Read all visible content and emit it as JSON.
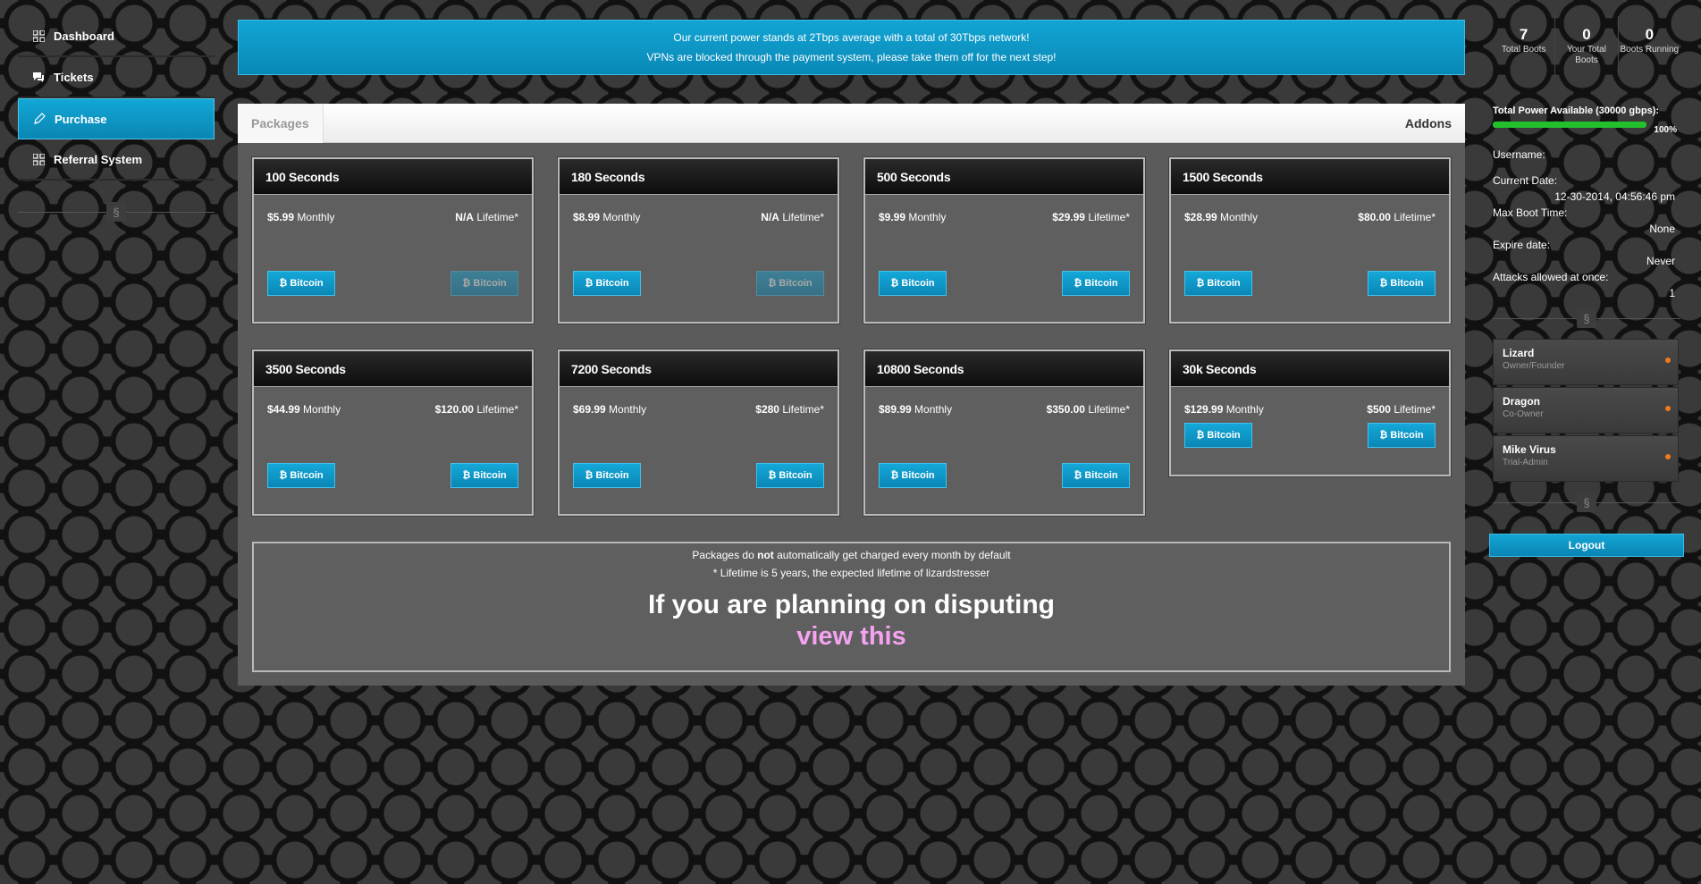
{
  "sidebar": {
    "items": [
      {
        "label": "Dashboard",
        "icon": "grid-icon"
      },
      {
        "label": "Tickets",
        "icon": "chat-icon"
      },
      {
        "label": "Purchase",
        "icon": "pencil-icon"
      },
      {
        "label": "Referral System",
        "icon": "grid-icon"
      }
    ],
    "divider_glyph": "§"
  },
  "banner": {
    "line1": "Our current power stands at 2Tbps average with a total of 30Tbps network!",
    "line2": "VPNs are blocked through the payment system, please take them off for the next step!"
  },
  "tabs": {
    "left": "Packages",
    "right": "Addons"
  },
  "packages": [
    {
      "title": "100 Seconds",
      "monthly": "$5.99",
      "monthly_label": "Monthly",
      "lifetime": "N/A",
      "lifetime_label": "Lifetime*",
      "btn": "₿ Bitcoin"
    },
    {
      "title": "180 Seconds",
      "monthly": "$8.99",
      "monthly_label": "Monthly",
      "lifetime": "N/A",
      "lifetime_label": "Lifetime*",
      "btn": "₿ Bitcoin"
    },
    {
      "title": "500 Seconds",
      "monthly": "$9.99",
      "monthly_label": "Monthly",
      "lifetime": "$29.99",
      "lifetime_label": "Lifetime*",
      "btn": "₿ Bitcoin"
    },
    {
      "title": "1500 Seconds",
      "monthly": "$28.99",
      "monthly_label": "Monthly",
      "lifetime": "$80.00",
      "lifetime_label": "Lifetime*",
      "btn": "₿ Bitcoin"
    },
    {
      "title": "3500 Seconds",
      "monthly": "$44.99",
      "monthly_label": "Monthly",
      "lifetime": "$120.00",
      "lifetime_label": "Lifetime*",
      "btn": "₿ Bitcoin"
    },
    {
      "title": "7200 Seconds",
      "monthly": "$69.99",
      "monthly_label": "Monthly",
      "lifetime": "$280",
      "lifetime_label": "Lifetime*",
      "btn": "₿ Bitcoin"
    },
    {
      "title": "10800 Seconds",
      "monthly": "$89.99",
      "monthly_label": "Monthly",
      "lifetime": "$350.00",
      "lifetime_label": "Lifetime*",
      "btn": "₿ Bitcoin"
    },
    {
      "title": "30k Seconds",
      "monthly": "$129.99",
      "monthly_label": "Monthly",
      "lifetime": "$500",
      "lifetime_label": "Lifetime*",
      "btn": "₿ Bitcoin"
    }
  ],
  "notice": {
    "line1_a": "Packages do",
    "line1_b": "not",
    "line1_c": "automatically get charged every month by default",
    "line2": "* Lifetime is 5 years, the expected lifetime of lizardstresser",
    "big": "If you are planning on disputing",
    "link": "view this"
  },
  "stats": [
    {
      "num": "7",
      "label": "Total Boots"
    },
    {
      "num": "0",
      "label": "Your Total Boots"
    },
    {
      "num": "0",
      "label": "Boots Running"
    }
  ],
  "power": {
    "title": "Total Power Available (30000 gbps):",
    "percent": "100%",
    "fill": 1.0
  },
  "account": {
    "username_label": "Username:",
    "date_label": "Current Date:",
    "date_value": "12-30-2014, 04:56:46 pm",
    "maxboot_label": "Max Boot Time:",
    "maxboot_value": "None",
    "expire_label": "Expire date:",
    "expire_value": "Never",
    "attacks_label": "Attacks allowed at once:",
    "attacks_value": "1"
  },
  "staff": [
    {
      "name": "Lizard",
      "role": "Owner/Founder"
    },
    {
      "name": "Dragon",
      "role": "Co-Owner"
    },
    {
      "name": "Mike Virus",
      "role": "Trial-Admin"
    }
  ],
  "logout": "Logout",
  "colors": {
    "accent": "#0e9acb",
    "online": "#f07a1e",
    "bar": "#22c02b",
    "link": "#f5a3f0"
  }
}
